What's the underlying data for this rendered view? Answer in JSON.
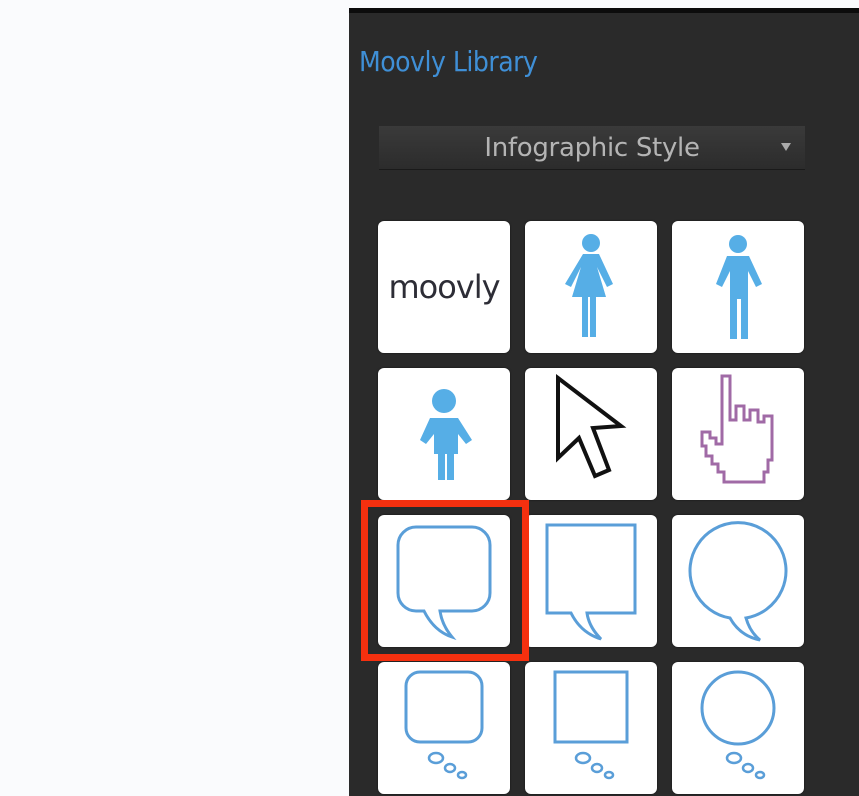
{
  "library": {
    "title": "Moovly Library",
    "dropdown": {
      "selected": "Infographic Style"
    },
    "logo_tile_text": "moovly"
  },
  "icons": [
    "moovly-logo-icon",
    "woman-figure-icon",
    "man-figure-icon",
    "child-figure-icon",
    "cursor-arrow-icon",
    "hand-pointer-icon",
    "rounded-speech-bubble-icon",
    "square-speech-bubble-icon",
    "round-speech-bubble-icon",
    "rounded-thought-bubble-icon",
    "square-thought-bubble-icon",
    "round-thought-bubble-icon"
  ],
  "colors": {
    "accent": "#3f8fd6",
    "figure": "#56aee6",
    "outline": "#5a9ed8",
    "hand": "#a06aa6",
    "highlight": "#f5300f",
    "panel": "#2a2a2a"
  }
}
